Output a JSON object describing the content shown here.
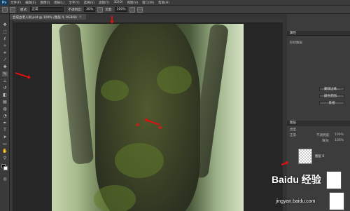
{
  "app": {
    "logo": "Ps"
  },
  "menubar": {
    "items": [
      "文件(F)",
      "编辑(E)",
      "图像(I)",
      "图层(L)",
      "文字(Y)",
      "选择(S)",
      "滤镜(T)",
      "3D(D)",
      "视图(V)",
      "窗口(W)",
      "帮助(H)"
    ]
  },
  "options": {
    "mode_label": "模式:",
    "mode_value": "正常",
    "opacity_label": "不透明度:",
    "opacity_value": "30%",
    "flow_label": "流量:",
    "flow_value": "100%"
  },
  "document_tab": {
    "label": "合成古老人树.psd @ 100% (图层 0, RGB/8)",
    "close": "×"
  },
  "properties": {
    "title": "属性",
    "subtitle": "形状图层",
    "btn_mask": "蒙版边缘...",
    "btn_color": "颜色范围...",
    "btn_invert": "反相"
  },
  "layers": {
    "title": "图层",
    "kind": "类型",
    "blend": "正常",
    "opacity_label": "不透明度:",
    "opacity_value": "100%",
    "fill_label": "填充:",
    "fill_value": "100%",
    "layer_name": "图层 0"
  },
  "watermark": {
    "brand": "Baidu 经验",
    "url": "jingyan.baidu.com"
  },
  "colors": {
    "accent_arrow": "#dd1111",
    "foreground": "#000000",
    "background": "#ffffff"
  }
}
